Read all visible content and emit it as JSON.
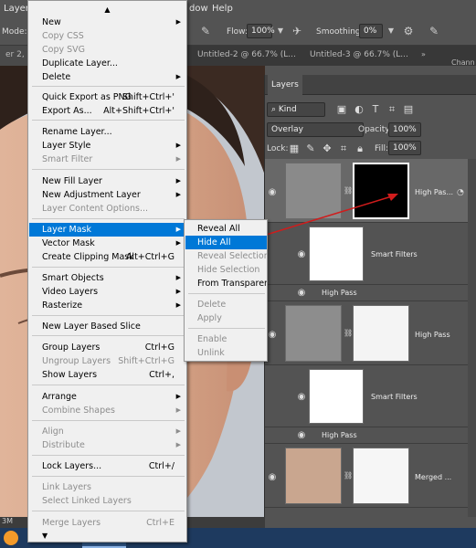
{
  "menubar": {
    "menu_layer": "Layer",
    "menu_window_fragment": "dow",
    "menu_help": "Help"
  },
  "options": {
    "mode_label": "Mode:",
    "flow_label": "Flow:",
    "flow_value": "100%",
    "smoothing_label": "Smoothing:",
    "smoothing_value": "0%"
  },
  "tabs": {
    "partial": "er 2, RG",
    "tab2": "Untitled-2 @ 66.7% (L...",
    "tab3": "Untitled-3 @ 66.7% (L...",
    "channels_partial": "Chann"
  },
  "status": {
    "doc_fragment": "3M"
  },
  "layers_panel": {
    "title": "Layers",
    "filter_kind": "Kind",
    "blend_mode": "Overlay",
    "opacity_label": "Opacity:",
    "opacity_value": "100%",
    "lock_label": "Lock:",
    "fill_label": "Fill:",
    "fill_value": "100%",
    "rows": [
      {
        "name": "High Pas..."
      },
      {
        "name": "Smart Filters"
      },
      {
        "name": "High Pass"
      },
      {
        "name": "High Pass"
      },
      {
        "name": "Smart Filters"
      },
      {
        "name": "High Pass"
      },
      {
        "name": "Merged ..."
      }
    ]
  },
  "menu": {
    "new": "New",
    "copy_css": "Copy CSS",
    "copy_svg": "Copy SVG",
    "duplicate": "Duplicate Layer...",
    "delete": "Delete",
    "quick_export": "Quick Export as PNG",
    "quick_export_sc": "Shift+Ctrl+'",
    "export_as": "Export As...",
    "export_as_sc": "Alt+Shift+Ctrl+'",
    "rename": "Rename Layer...",
    "layer_style": "Layer Style",
    "smart_filter": "Smart Filter",
    "new_fill": "New Fill Layer",
    "new_adjustment": "New Adjustment Layer",
    "layer_content_options": "Layer Content Options...",
    "layer_mask": "Layer Mask",
    "vector_mask": "Vector Mask",
    "clipping_mask": "Create Clipping Mask",
    "clipping_mask_sc": "Alt+Ctrl+G",
    "smart_objects": "Smart Objects",
    "video_layers": "Video Layers",
    "rasterize": "Rasterize",
    "slice": "New Layer Based Slice",
    "group": "Group Layers",
    "group_sc": "Ctrl+G",
    "ungroup": "Ungroup Layers",
    "ungroup_sc": "Shift+Ctrl+G",
    "show_layers": "Show Layers",
    "show_layers_sc": "Ctrl+,",
    "arrange": "Arrange",
    "combine_shapes": "Combine Shapes",
    "align": "Align",
    "distribute": "Distribute",
    "lock_layers": "Lock Layers...",
    "lock_layers_sc": "Ctrl+/",
    "link_layers": "Link Layers",
    "select_linked": "Select Linked Layers",
    "merge_layers": "Merge Layers",
    "merge_layers_sc": "Ctrl+E"
  },
  "submenu": {
    "reveal_all": "Reveal All",
    "hide_all": "Hide All",
    "reveal_selection": "Reveal Selection",
    "hide_selection": "Hide Selection",
    "from_transparency": "From Transparency",
    "delete": "Delete",
    "apply": "Apply",
    "enable": "Enable",
    "unlink": "Unlink"
  },
  "colors": {
    "menu_highlight": "#0078d7",
    "annotation_arrow": "#d01c1c"
  }
}
